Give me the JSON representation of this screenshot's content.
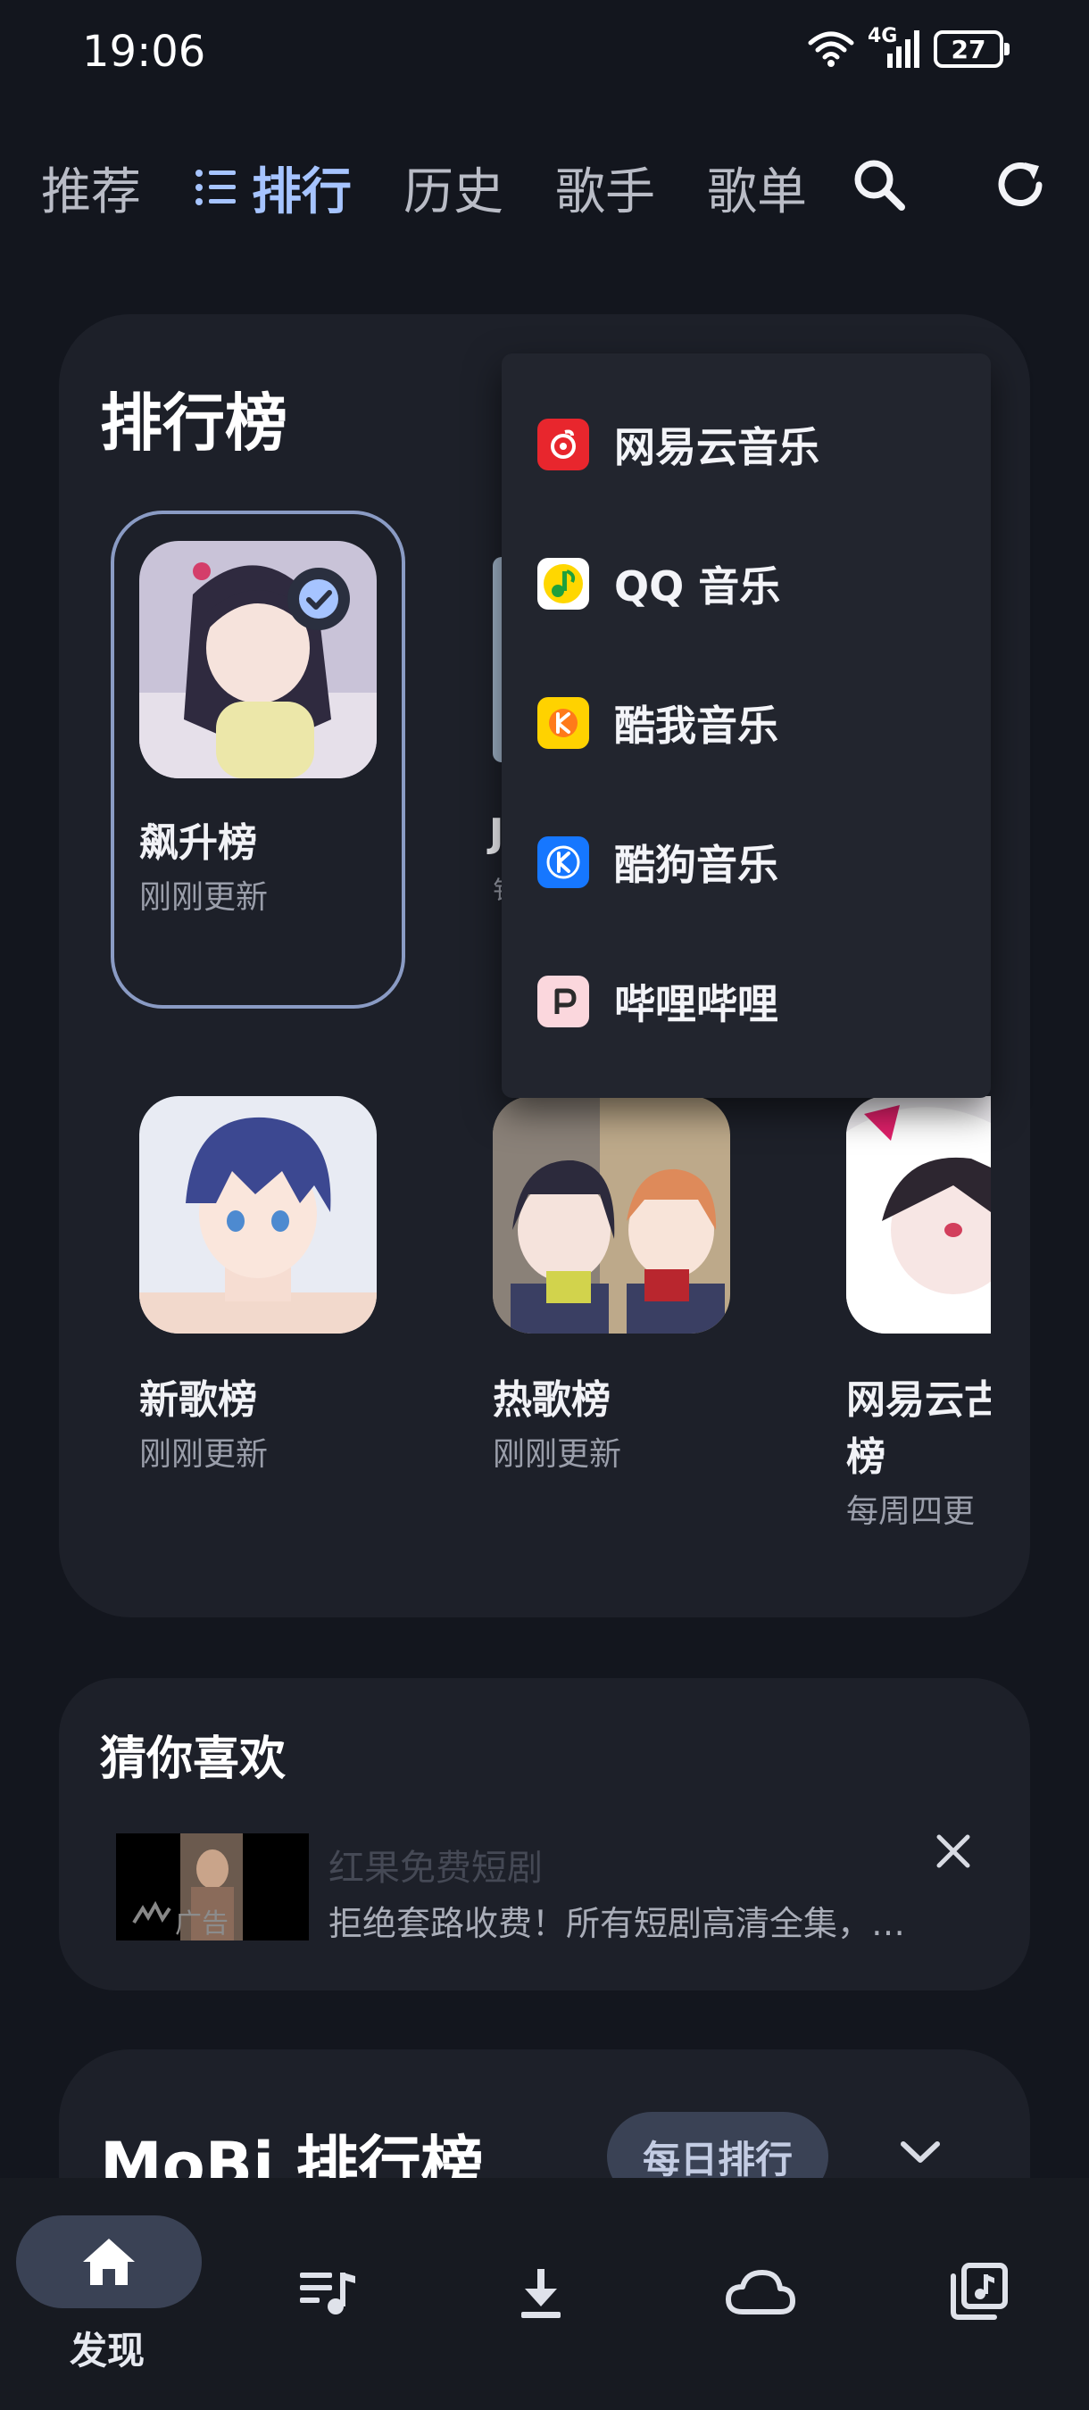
{
  "status_bar": {
    "time": "19:06",
    "network": "4G",
    "battery": "27",
    "icons": [
      "wifi-icon",
      "signal-icon",
      "battery-icon"
    ]
  },
  "top_nav": {
    "tabs": [
      {
        "label": "推荐",
        "active": false
      },
      {
        "label": "排行",
        "active": true,
        "icon": "list-icon"
      },
      {
        "label": "历史",
        "active": false
      },
      {
        "label": "歌手",
        "active": false
      },
      {
        "label": "歌单",
        "active": false
      }
    ],
    "actions": [
      "search-icon",
      "refresh-icon"
    ],
    "accent_color": "#a6c4ff"
  },
  "ranking": {
    "title": "排行榜",
    "charts": [
      {
        "title": "飙升榜",
        "subtitle": "刚刚更新",
        "selected": true
      },
      {
        "title": "新歌榜",
        "subtitle": "刚刚更新"
      },
      {
        "title": "热歌榜",
        "subtitle": "刚刚更新"
      },
      {
        "title": "网易云古",
        "title_line2": "榜",
        "subtitle": "每周四更"
      }
    ],
    "partial_hidden_title": "J",
    "partial_hidden_sub": "钅"
  },
  "source_menu": {
    "items": [
      {
        "label": "网易云音乐",
        "icon": "netease-music-icon",
        "color": "#e8262d"
      },
      {
        "label": "QQ 音乐",
        "icon": "qq-music-icon",
        "color": "#ffd700"
      },
      {
        "label": "酷我音乐",
        "icon": "kuwo-music-icon",
        "color": "#ffd200"
      },
      {
        "label": "酷狗音乐",
        "icon": "kugou-music-icon",
        "color": "#1677ff"
      },
      {
        "label": "哔哩哔哩",
        "icon": "bilibili-icon",
        "color": "#fbd7dd"
      }
    ]
  },
  "guess": {
    "title": "猜你喜欢",
    "ad": {
      "title": "红果免费短剧",
      "description": "拒绝套路收费！所有短剧高清全集，…",
      "tag": "广告"
    }
  },
  "mobi": {
    "title": "MoBi 排行榜",
    "chip": "每日排行"
  },
  "bottom_nav": {
    "items": [
      {
        "label": "发现",
        "icon": "home-icon",
        "active": true
      },
      {
        "label": "",
        "icon": "playlist-icon"
      },
      {
        "label": "",
        "icon": "download-icon"
      },
      {
        "label": "",
        "icon": "cloud-icon"
      },
      {
        "label": "",
        "icon": "music-library-icon"
      }
    ]
  }
}
